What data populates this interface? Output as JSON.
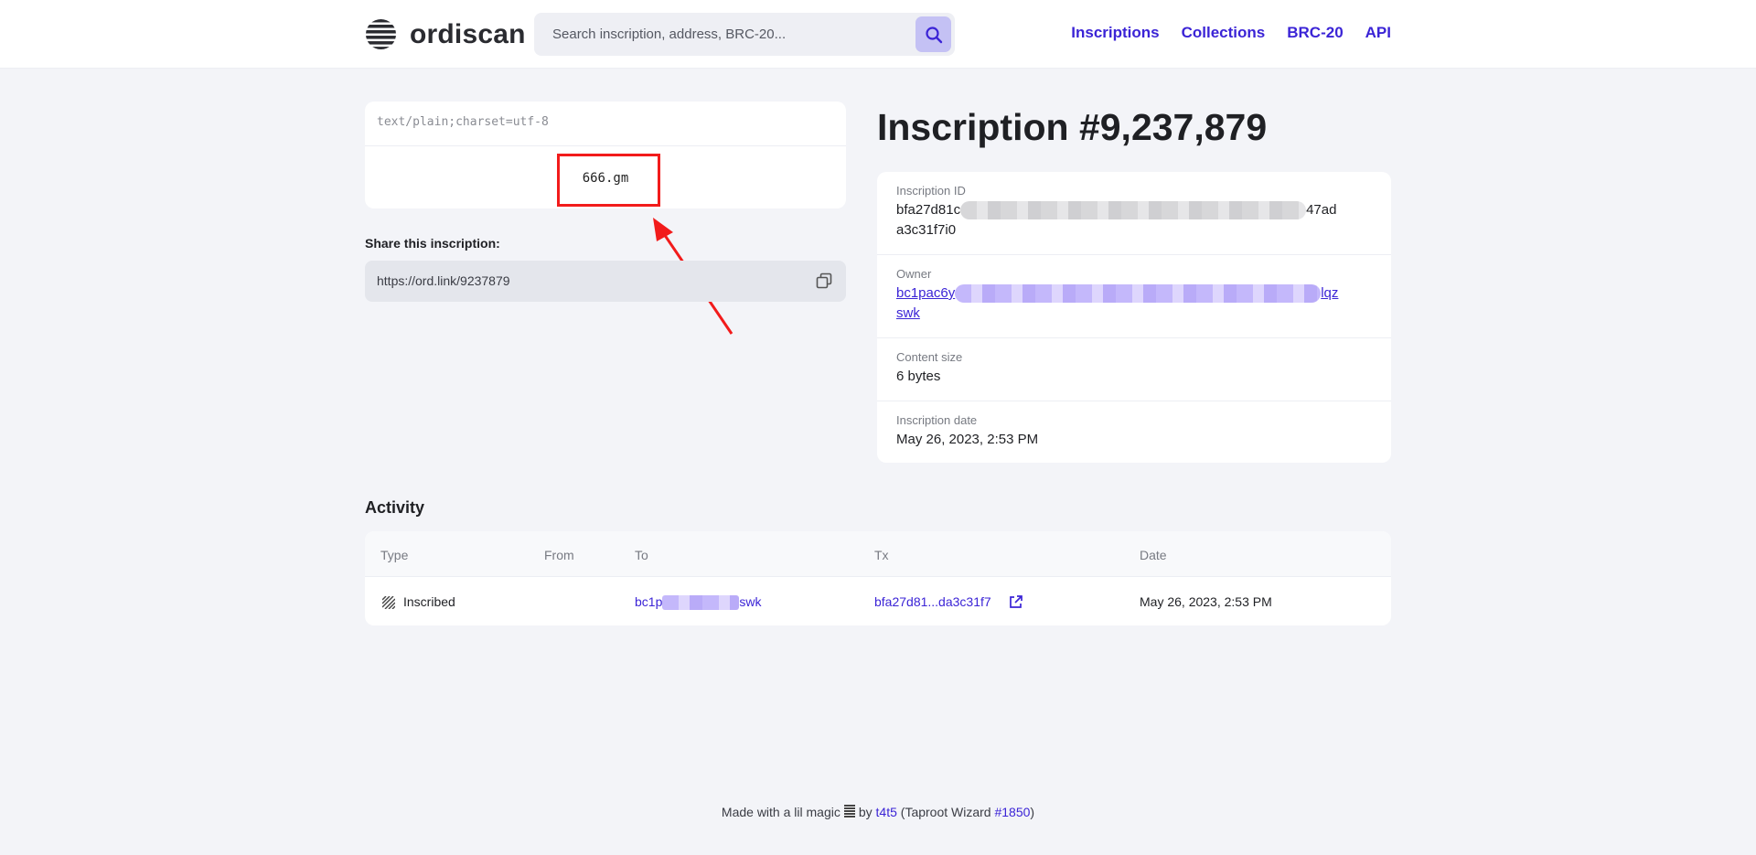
{
  "header": {
    "brand": "ordiscan",
    "search_placeholder": "Search inscription, address, BRC-20...",
    "nav": [
      "Inscriptions",
      "Collections",
      "BRC-20",
      "API"
    ]
  },
  "preview": {
    "content_type": "text/plain;charset=utf-8",
    "content": "666.gm"
  },
  "share": {
    "label": "Share this inscription:",
    "url": "https://ord.link/9237879"
  },
  "inscription": {
    "title": "Inscription #9,237,879",
    "fields": [
      {
        "label": "Inscription ID",
        "value_start": "bfa27d81c",
        "value_end": "47ad",
        "value_line2": "a3c31f7i0"
      },
      {
        "label": "Owner",
        "value_start": "bc1pac6y",
        "value_end": "lqz",
        "value_line2": "swk"
      },
      {
        "label": "Content size",
        "value": "6 bytes"
      },
      {
        "label": "Inscription date",
        "value": "May 26, 2023, 2:53 PM"
      }
    ]
  },
  "activity": {
    "title": "Activity",
    "columns": [
      "Type",
      "From",
      "To",
      "Tx",
      "Date"
    ],
    "rows": [
      {
        "type": "Inscribed",
        "from": "",
        "to_start": "bc1p",
        "to_end": "swk",
        "tx": "bfa27d81...da3c31f7",
        "date": "May 26, 2023, 2:53 PM"
      }
    ]
  },
  "footer": {
    "text": "Made with a lil magic",
    "by": "by",
    "author": "t4t5",
    "wizard_open": "(Taproot Wizard",
    "wizard_num": "#1850",
    "wizard_close": ")"
  },
  "colors": {
    "accent": "#3b24d6",
    "annotation": "#f21b1b",
    "page_bg": "#f3f4f8"
  }
}
